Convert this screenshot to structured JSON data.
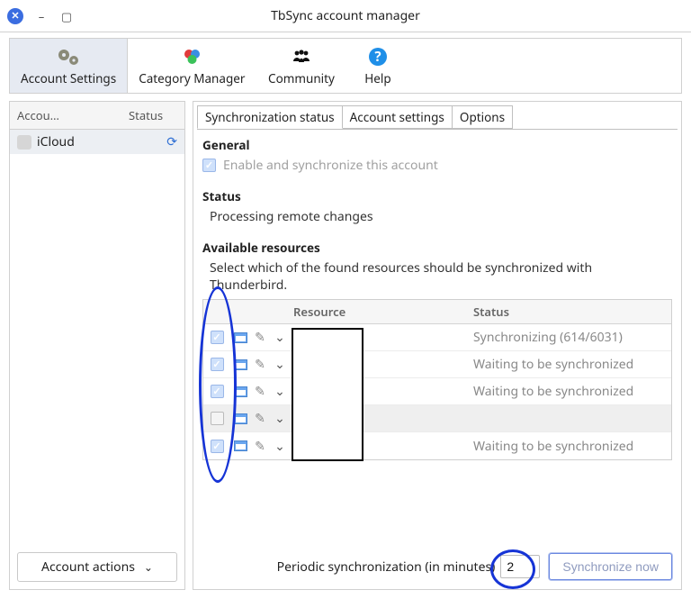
{
  "window": {
    "title": "TbSync account manager"
  },
  "toolbar": {
    "settings": "Account Settings",
    "category": "Category Manager",
    "community": "Community",
    "help": "Help"
  },
  "sidebar": {
    "cols": {
      "account": "Accou…",
      "status": "Status"
    },
    "accounts": [
      {
        "name": "iCloud"
      }
    ],
    "actions_label": "Account actions"
  },
  "tabs": {
    "sync": "Synchronization status",
    "acct": "Account settings",
    "opts": "Options"
  },
  "sections": {
    "general": "General",
    "status": "Status",
    "avail": "Available resources"
  },
  "general": {
    "enable_label": "Enable and synchronize this account"
  },
  "status_text": "Processing remote changes",
  "avail_desc": "Select which of the found resources should be synchronized with Thunderbird.",
  "res_head": {
    "resource": "Resource",
    "status": "Status"
  },
  "resources": [
    {
      "checked": true,
      "status": "Synchronizing (614/6031)"
    },
    {
      "checked": true,
      "status": "Waiting to be synchronized"
    },
    {
      "checked": true,
      "status": "Waiting to be synchronized"
    },
    {
      "checked": false,
      "status": "",
      "warn": true
    },
    {
      "checked": true,
      "status": "Waiting to be synchronized"
    }
  ],
  "footer": {
    "label": "Periodic synchronization (in minutes)",
    "value": "2",
    "sync_now": "Synchronize now"
  }
}
